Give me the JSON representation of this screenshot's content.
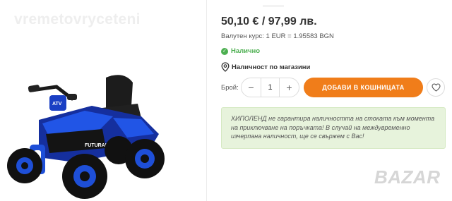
{
  "watermarks": {
    "left": "vremetovryceteni",
    "right": "BAZAR"
  },
  "product": {
    "price": "50,10 € / 97,99 лв.",
    "exchange_rate": "Валутен курс: 1 EUR = 1.95583 BGN",
    "stock_status": "Налично",
    "store_availability": "Наличност по магазини",
    "atv_labels": {
      "badge": "ATV",
      "side": "FUTURALE"
    }
  },
  "purchase": {
    "qty_label": "Брой:",
    "qty_value": "1",
    "minus": "−",
    "plus": "+",
    "add_to_cart": "ДОБАВИ В КОШНИЦАТА"
  },
  "notice": {
    "text": "ХИПОЛЕНД не гарантира наличността на стоката към момента на приключване на поръчката! В случай на междувременно изчерпана наличност, ще се свържем с Вас!"
  },
  "colors": {
    "accent": "#f07d1a",
    "in_stock": "#4caf50",
    "notice_bg": "#e7f3dc",
    "atv_blue": "#1e4fd8"
  },
  "icons": {
    "stock": "check-circle-icon",
    "stores": "map-pin-icon",
    "wishlist": "heart-icon"
  }
}
